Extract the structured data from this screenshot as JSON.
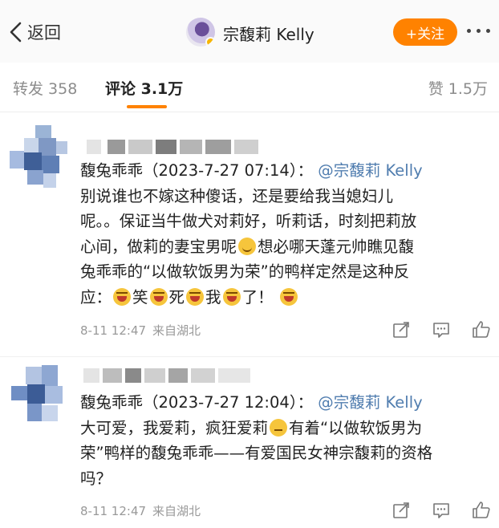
{
  "nav": {
    "back_label": "返回",
    "title": "宗馥莉 Kelly",
    "follow_label": "+关注"
  },
  "tabs": {
    "repost_label": "转发 358",
    "comments_label": "评论 3.1万",
    "likes_label": "赞 1.5万"
  },
  "comments": [
    {
      "lines": [
        [
          "馥兔乖乖（2023-7-27 07:14）：",
          "@宗馥莉 Kelly"
        ],
        [
          "别说谁也不嫁这种傻话，还是要给我当媳妇儿"
        ],
        [
          "呢。。保证当牛做犬对莉好，听莉话，时刻把莉放"
        ],
        [
          "心间，做莉的妻宝男呢",
          "想必哪天蓬元帅瞧见馥"
        ],
        [
          "兔乖乖的“以做软饭男为荣”的鸭样定然是这种反"
        ],
        [
          "应：",
          "笑",
          "死",
          "我",
          "了！"
        ]
      ],
      "time": "8-11 12:47",
      "location": "来自湖北"
    },
    {
      "lines": [
        [
          "馥兔乖乖（2023-7-27 12:04）：",
          "@宗馥莉 Kelly"
        ],
        [
          "大可爱，我爱莉，疯狂爱莉",
          "有着“以做软饭男为"
        ],
        [
          "荣”鸭样的馥兔乖乖——有爱国民女神宗馥莉的资格"
        ],
        [
          "吗？"
        ]
      ],
      "time": "8-11 12:47",
      "location": "来自湖北"
    }
  ],
  "icons": [
    "chevron-left-icon",
    "more-dots-icon",
    "emoji-smile-icon",
    "emoji-laugh-icon",
    "emoji-think-icon",
    "share-icon",
    "comment-icon",
    "like-icon"
  ],
  "colors": {
    "accent": "#ff8200",
    "mention": "#507daf",
    "meta": "#999999"
  }
}
